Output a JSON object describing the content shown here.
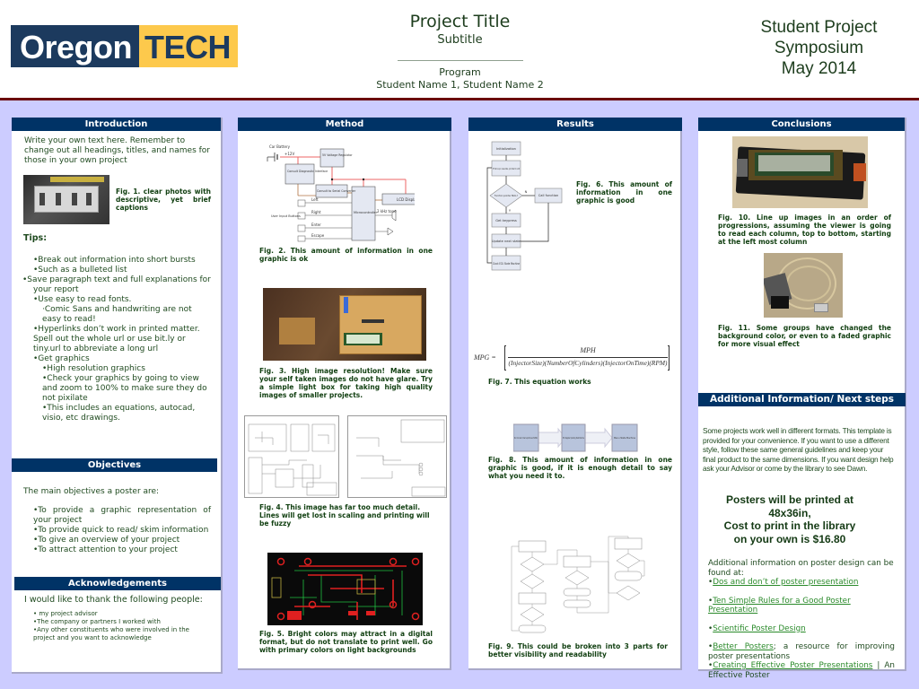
{
  "header": {
    "logo": {
      "part1": "Oregon",
      "part2": "TECH"
    },
    "title": "Project Title",
    "subtitle": "Subtitle",
    "program": "Program",
    "students": "Student Name 1, Student Name 2",
    "event_line1": "Student Project",
    "event_line2": "Symposium",
    "event_line3": "May 2014"
  },
  "colors": {
    "section_header": "#003366",
    "background": "#ccccff",
    "header_rule": "#6b0a0a",
    "text": "#1f4a1f",
    "link": "#2a8a2a"
  },
  "introduction": {
    "heading": "Introduction",
    "body": "Write your own text here. Remember to change out all headings, titles, and names for those in your own project",
    "fig1_caption": "Fig. 1.  clear photos with descriptive, yet brief captions",
    "tips_heading": "Tips:",
    "tips": [
      {
        "level": 1,
        "text": "•Break out information into short bursts"
      },
      {
        "level": 1,
        "text": "•Such as a bulleted list"
      },
      {
        "level": 1,
        "text": "•Save paragraph text and full explanations for your report"
      },
      {
        "level": 1,
        "text": "•Use easy to read fonts."
      },
      {
        "level": 2,
        "text": "·Comic Sans and handwriting are not easy to read!"
      },
      {
        "level": 1,
        "text": "•Hyperlinks don’t work in printed matter. Spell out the whole url or use bit.ly or tiny.url to abbreviate a long url"
      },
      {
        "level": 1,
        "text": "•Get graphics"
      },
      {
        "level": 2,
        "text": "•High resolution graphics"
      },
      {
        "level": 2,
        "text": "•Check your graphics by going to view and zoom to 100% to make sure they do not pixilate"
      },
      {
        "level": 2,
        "text": "•This includes an equations, autocad, visio, etc drawings."
      }
    ]
  },
  "objectives": {
    "heading": "Objectives",
    "intro": "The main objectives a poster are:",
    "items": [
      "•To provide a graphic representation of your project",
      "•To provide quick to read/ skim information",
      "•To give an overview of your project",
      "•To attract attention to your project"
    ]
  },
  "acknowledgements": {
    "heading": "Acknowledgements",
    "intro": "I would like to thank the following people:",
    "items": [
      "• my project advisor",
      "•The company or partners I worked with",
      "•Any other constituents who were involved in the project and you want to acknowledge"
    ]
  },
  "method": {
    "heading": "Method",
    "diagram_labels": {
      "battery": "Car Battery",
      "v12": "+12V",
      "regulator": "5V Voltage Regulator",
      "consult": "Consult Diagnostic Interface",
      "converter": "Consult to Serial Converter",
      "mcu": "Microcontroller",
      "lcd": "LCD Display",
      "buttons": "User Input Buttons",
      "left": "Left",
      "right": "Right",
      "enter": "Enter",
      "escape": "Escape",
      "tone": "2 kHz tone"
    },
    "fig2_caption": "Fig. 2.  This amount of information in one graphic is ok",
    "fig3_caption": "Fig. 3.  High image resolution! Make sure your self taken images do not have glare. Try a simple light box for taking high quality images of smaller projects.",
    "fig4_caption": "Fig. 4.  This image has far too much detail. Lines will get lost in scaling and printing will be fuzzy",
    "fig5_caption": "Fig. 5.  Bright colors may attract in a digital format, but do not translate to print well. Go with primary colors on light backgrounds"
  },
  "results": {
    "heading": "Results",
    "flow": {
      "init": "Initialization",
      "loop": "If first loop in new state, print text to LCD",
      "decision": "Function pointer NULL?",
      "call": "Call function",
      "keypress": "Get keypress",
      "update": "Update next state",
      "clock": "Clock ECU State Machine",
      "yes": "Y",
      "no": "N"
    },
    "fig6_caption": "Fig. 6.   This amount of information in one graphic is good",
    "equation_lhs": "MPG =",
    "equation_num": "MPH",
    "equation_den": "(InjectorSize)(NumberOfCylinders)(InjectorOnTime)(RPM)",
    "fig7_caption": "Fig. 7.  This equation works",
    "blocks": [
      "Rx Circular Interrupt-driven Buffer",
      "ECU Register Updating State Machine",
      "Menu State Machine"
    ],
    "fig8_caption": "Fig. 8. This amount of information in one graphic is good, if it is enough detail to say what you need it to.",
    "fig9_caption": "Fig. 9. This could be broken into 3 parts for better visibility and readability"
  },
  "conclusions": {
    "heading": "Conclusions",
    "fig10_caption": "Fig. 10. Line up images in an order of progressions, assuming the viewer is going to read each column, top to bottom, starting at the left most column",
    "fig11_caption": "Fig. 11.  Some groups have changed the background color, or even to a faded graphic for more visual effect"
  },
  "additional": {
    "heading": "Additional Information/ Next steps",
    "body": "Some projects work well in different formats. This template is provided for your convenience. If you want to use a different style, follow these same general guidelines and keep your final product to the same dimensions. If you want design help ask your Advisor or come by the library to see Dawn.",
    "print_line1": "Posters will be printed at",
    "print_line2": "48x36in,",
    "print_line3": "Cost to print in the library",
    "print_line4": "on your own is $16.80",
    "links_intro": "Additional information on poster design can be found at:",
    "link1": "Dos and don’t of poster presentation",
    "link2": "Ten Simple Rules for a Good Poster Presentation",
    "link3": "Scientific Poster Design",
    "link4": "Better Posters",
    "link4_suffix": "; a resource for improving poster presentations",
    "link5": "Creating Effective Poster Presentations",
    "link5_suffix": " | An Effective Poster"
  }
}
